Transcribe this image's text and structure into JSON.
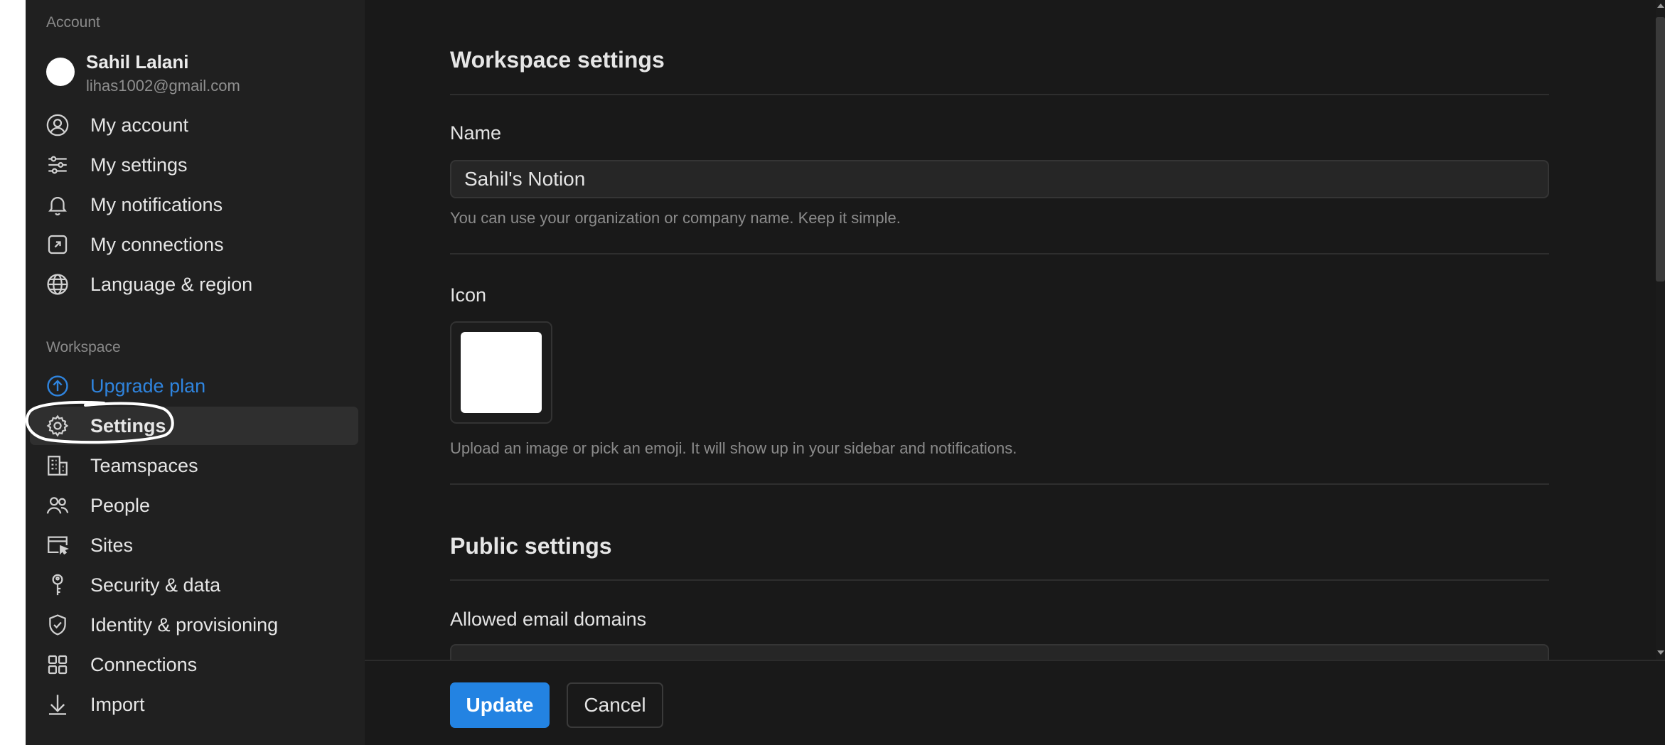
{
  "sidebar": {
    "account_section_label": "Account",
    "profile": {
      "name": "Sahil Lalani",
      "email": "lihas1002@gmail.com"
    },
    "account_items": [
      {
        "label": "My account",
        "icon": "user-circle-icon"
      },
      {
        "label": "My settings",
        "icon": "sliders-icon"
      },
      {
        "label": "My notifications",
        "icon": "bell-icon"
      },
      {
        "label": "My connections",
        "icon": "external-link-icon"
      },
      {
        "label": "Language & region",
        "icon": "globe-icon"
      }
    ],
    "workspace_section_label": "Workspace",
    "workspace_items": [
      {
        "label": "Upgrade plan",
        "icon": "arrow-up-circle-icon"
      },
      {
        "label": "Settings",
        "icon": "gear-icon",
        "active": true
      },
      {
        "label": "Teamspaces",
        "icon": "building-icon"
      },
      {
        "label": "People",
        "icon": "people-icon"
      },
      {
        "label": "Sites",
        "icon": "browser-cursor-icon"
      },
      {
        "label": "Security & data",
        "icon": "key-icon"
      },
      {
        "label": "Identity & provisioning",
        "icon": "shield-check-icon"
      },
      {
        "label": "Connections",
        "icon": "grid-icon"
      },
      {
        "label": "Import",
        "icon": "download-arrow-icon"
      }
    ]
  },
  "main": {
    "title": "Workspace settings",
    "name_field": {
      "label": "Name",
      "value": "Sahil's Notion",
      "help": "You can use your organization or company name. Keep it simple."
    },
    "icon_field": {
      "label": "Icon",
      "help": "Upload an image or pick an emoji. It will show up in your sidebar and notifications."
    },
    "public_settings": {
      "title": "Public settings",
      "allowed_domains_label": "Allowed email domains"
    }
  },
  "footer": {
    "update_label": "Update",
    "cancel_label": "Cancel"
  },
  "colors": {
    "accent": "#2383e2",
    "upgrade_link": "#2f84de",
    "sidebar_bg": "#202020",
    "main_bg": "#191919",
    "active_item_bg": "#2f2f2f"
  }
}
